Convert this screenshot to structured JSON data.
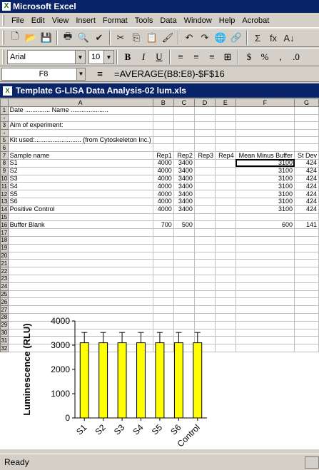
{
  "app": {
    "title": "Microsoft Excel",
    "icon": "excel-icon"
  },
  "menu": [
    "File",
    "Edit",
    "View",
    "Insert",
    "Format",
    "Tools",
    "Data",
    "Window",
    "Help",
    "Acrobat"
  ],
  "standard_toolbar": [
    {
      "name": "new-icon",
      "glyph": "🗋"
    },
    {
      "name": "open-icon",
      "glyph": "📂"
    },
    {
      "name": "save-icon",
      "glyph": "💾"
    },
    {
      "name": "print-icon",
      "glyph": "🖶"
    },
    {
      "name": "print-preview-icon",
      "glyph": "🔍"
    },
    {
      "name": "spelling-icon",
      "glyph": "✔"
    },
    {
      "name": "cut-icon",
      "glyph": "✂"
    },
    {
      "name": "copy-icon",
      "glyph": "⎘"
    },
    {
      "name": "paste-icon",
      "glyph": "📋"
    },
    {
      "name": "format-painter-icon",
      "glyph": "🖌"
    },
    {
      "name": "undo-icon",
      "glyph": "↶"
    },
    {
      "name": "redo-icon",
      "glyph": "↷"
    },
    {
      "name": "hyperlink-icon",
      "glyph": "🌐"
    },
    {
      "name": "web-toolbar-icon",
      "glyph": "🔗"
    },
    {
      "name": "autosum-icon",
      "glyph": "Σ"
    },
    {
      "name": "function-icon",
      "glyph": "fx"
    },
    {
      "name": "sort-ascending-icon",
      "glyph": "A↓"
    }
  ],
  "format_toolbar": {
    "font": "Arial",
    "size": "10",
    "buttons": [
      {
        "name": "bold-icon",
        "glyph": "B"
      },
      {
        "name": "italic-icon",
        "glyph": "I"
      },
      {
        "name": "underline-icon",
        "glyph": "U"
      },
      {
        "name": "align-left-icon",
        "glyph": "≡"
      },
      {
        "name": "align-center-icon",
        "glyph": "≡"
      },
      {
        "name": "align-right-icon",
        "glyph": "≡"
      },
      {
        "name": "merge-center-icon",
        "glyph": "⊞"
      },
      {
        "name": "currency-icon",
        "glyph": "$"
      },
      {
        "name": "percent-icon",
        "glyph": "%"
      },
      {
        "name": "comma-icon",
        "glyph": ","
      },
      {
        "name": "increase-decimal-icon",
        "glyph": ".0"
      }
    ]
  },
  "formula_bar": {
    "cell": "F8",
    "eq": "=",
    "formula": "=AVERAGE(B8:E8)-$F$16"
  },
  "workbook": {
    "title": "Template G-LISA Data Analysis-02 lum.xls"
  },
  "columns": [
    "A",
    "B",
    "C",
    "D",
    "E",
    "F",
    "G"
  ],
  "rows": [
    {
      "n": "1",
      "cells": [
        "Date .............. Name .....................",
        "",
        "",
        "",
        "",
        "",
        ""
      ]
    },
    {
      "n": "2",
      "cells": [
        "",
        "",
        "",
        "",
        "",
        "",
        ""
      ]
    },
    {
      "n": "3",
      "cells": [
        "Aim of experiment:",
        "",
        "",
        "",
        "",
        "",
        ""
      ]
    },
    {
      "n": "4",
      "cells": [
        "",
        "",
        "",
        "",
        "",
        "",
        ""
      ]
    },
    {
      "n": "5",
      "cells": [
        "Kit used:.......................... (from Cytoskeleton Inc.)",
        "",
        "",
        "",
        "",
        "",
        ""
      ]
    },
    {
      "n": "6",
      "cells": [
        "",
        "",
        "",
        "",
        "",
        "",
        ""
      ]
    },
    {
      "n": "7",
      "cells": [
        "Sample name",
        "Rep1",
        "Rep2",
        "Rep3",
        "Rep4",
        "Mean Minus Buffer",
        "St Dev"
      ]
    },
    {
      "n": "8",
      "cells": [
        "S1",
        "4000",
        "3400",
        "",
        "",
        "3100",
        "424"
      ]
    },
    {
      "n": "9",
      "cells": [
        "S2",
        "4000",
        "3400",
        "",
        "",
        "3100",
        "424"
      ]
    },
    {
      "n": "10",
      "cells": [
        "S3",
        "4000",
        "3400",
        "",
        "",
        "3100",
        "424"
      ]
    },
    {
      "n": "11",
      "cells": [
        "S4",
        "4000",
        "3400",
        "",
        "",
        "3100",
        "424"
      ]
    },
    {
      "n": "12",
      "cells": [
        "S5",
        "4000",
        "3400",
        "",
        "",
        "3100",
        "424"
      ]
    },
    {
      "n": "13",
      "cells": [
        "S6",
        "4000",
        "3400",
        "",
        "",
        "3100",
        "424"
      ]
    },
    {
      "n": "14",
      "cells": [
        "Positive Control",
        "4000",
        "3400",
        "",
        "",
        "3100",
        "424"
      ]
    },
    {
      "n": "15",
      "cells": [
        "",
        "",
        "",
        "",
        "",
        "",
        ""
      ]
    },
    {
      "n": "16",
      "cells": [
        "Buffer Blank",
        "700",
        "500",
        "",
        "",
        "600",
        "141"
      ]
    },
    {
      "n": "17",
      "cells": [
        "",
        "",
        "",
        "",
        "",
        "",
        ""
      ]
    },
    {
      "n": "18",
      "cells": [
        "",
        "",
        "",
        "",
        "",
        "",
        ""
      ]
    },
    {
      "n": "19",
      "cells": [
        "",
        "",
        "",
        "",
        "",
        "",
        ""
      ]
    },
    {
      "n": "20",
      "cells": [
        "",
        "",
        "",
        "",
        "",
        "",
        ""
      ]
    },
    {
      "n": "21",
      "cells": [
        "",
        "",
        "",
        "",
        "",
        "",
        ""
      ]
    },
    {
      "n": "22",
      "cells": [
        "",
        "",
        "",
        "",
        "",
        "",
        ""
      ]
    },
    {
      "n": "23",
      "cells": [
        "",
        "",
        "",
        "",
        "",
        "",
        ""
      ]
    },
    {
      "n": "24",
      "cells": [
        "",
        "",
        "",
        "",
        "",
        "",
        ""
      ]
    },
    {
      "n": "25",
      "cells": [
        "",
        "",
        "",
        "",
        "",
        "",
        ""
      ]
    },
    {
      "n": "26",
      "cells": [
        "",
        "",
        "",
        "",
        "",
        "",
        ""
      ]
    },
    {
      "n": "27",
      "cells": [
        "",
        "",
        "",
        "",
        "",
        "",
        ""
      ]
    },
    {
      "n": "28",
      "cells": [
        "",
        "",
        "",
        "",
        "",
        "",
        ""
      ]
    },
    {
      "n": "29",
      "cells": [
        "",
        "",
        "",
        "",
        "",
        "",
        ""
      ]
    },
    {
      "n": "30",
      "cells": [
        "",
        "",
        "",
        "",
        "",
        "",
        ""
      ]
    },
    {
      "n": "31",
      "cells": [
        "",
        "",
        "",
        "",
        "",
        "",
        ""
      ]
    },
    {
      "n": "32",
      "cells": [
        "",
        "",
        "",
        "",
        "",
        "",
        ""
      ]
    }
  ],
  "chart_data": {
    "type": "bar",
    "categories": [
      "S1",
      "S2",
      "S3",
      "S4",
      "S5",
      "S6",
      "Control"
    ],
    "values": [
      3100,
      3100,
      3100,
      3100,
      3100,
      3100,
      3100
    ],
    "error": [
      424,
      424,
      424,
      424,
      424,
      424,
      424
    ],
    "ylabel": "Luminescence (RLU)",
    "ylim": [
      0,
      4000
    ],
    "yticks": [
      "0",
      "1000",
      "2000",
      "3000",
      "4000"
    ],
    "bar_color": "#ffff00",
    "grid": false
  },
  "status": "Ready"
}
